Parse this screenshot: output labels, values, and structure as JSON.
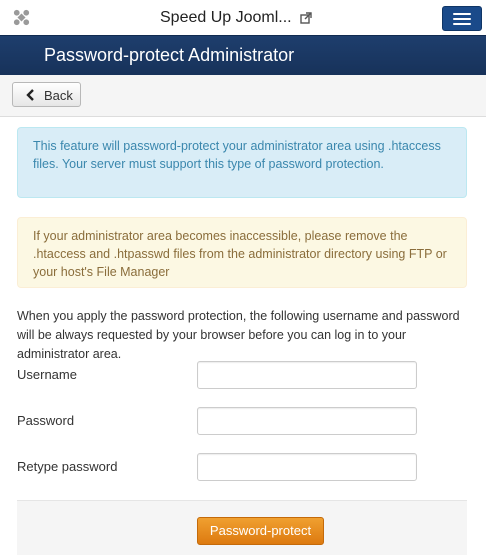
{
  "header": {
    "site_title": "Speed Up Jooml...",
    "logo_icon": "joomla-logo-icon",
    "external_link_icon": "external-link-icon",
    "menu_icon": "hamburger-menu-icon"
  },
  "title_bar": {
    "page_title": "Password-protect Administrator"
  },
  "toolbar": {
    "back_label": "Back",
    "back_icon": "chevron-left-icon"
  },
  "alerts": {
    "info": "This feature will password-protect your administrator area using .htaccess files. Your server must support this type of password protection.",
    "warning": "If your administrator area becomes inaccessible, please remove the .htaccess and .htpasswd files from the administrator directory using FTP or your host's File Manager"
  },
  "form": {
    "description": "When you apply the password protection, the following username and password will be always requested by your browser before you can log in to your administrator area.",
    "username_label": "Username",
    "username_value": "",
    "password_label": "Password",
    "password_value": "",
    "retype_label": "Retype password",
    "retype_value": "",
    "submit_label": "Password-protect"
  },
  "colors": {
    "title_bar": "#1e3e6d",
    "menu_button": "#1a4a8a",
    "submit_button": "#e88a1a",
    "info_bg": "#d9edf7",
    "warning_bg": "#fcf8e3"
  }
}
